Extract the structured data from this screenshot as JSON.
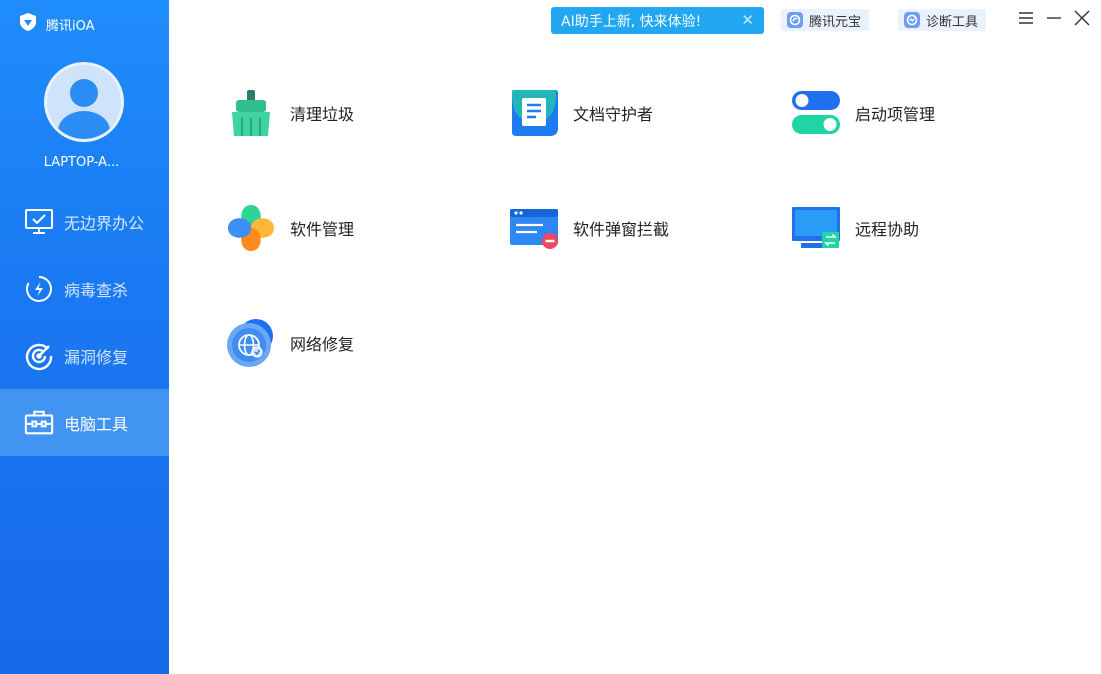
{
  "brand": {
    "name": "腾讯iOA",
    "logo_icon": "shield-logo-icon"
  },
  "user": {
    "device_name": "LAPTOP-A...",
    "avatar_icon": "user-avatar-icon"
  },
  "nav": {
    "items": [
      {
        "label": "无边界办公",
        "icon": "monitor-check-icon",
        "active": false
      },
      {
        "label": "病毒查杀",
        "icon": "lightning-circle-icon",
        "active": false
      },
      {
        "label": "漏洞修复",
        "icon": "target-icon",
        "active": false
      },
      {
        "label": "电脑工具",
        "icon": "toolbox-icon",
        "active": true
      }
    ]
  },
  "topbar": {
    "ai_banner": "AI助手上新, 快来体验!",
    "yuanbao_label": "腾讯元宝",
    "diagnose_label": "诊断工具"
  },
  "tools": [
    {
      "label": "清理垃圾",
      "icon": "broom-icon"
    },
    {
      "label": "文档守护者",
      "icon": "document-guard-icon"
    },
    {
      "label": "启动项管理",
      "icon": "startup-toggle-icon"
    },
    {
      "label": "软件管理",
      "icon": "clover-icon"
    },
    {
      "label": "软件弹窗拦截",
      "icon": "popup-block-icon"
    },
    {
      "label": "远程协助",
      "icon": "remote-monitor-icon"
    },
    {
      "label": "网络修复",
      "icon": "network-globe-icon"
    }
  ],
  "colors": {
    "sidebar": "#1a78f2",
    "active_nav": "#4294f2",
    "banner": "#21a7f2",
    "chip_bg": "#e9f2fd"
  }
}
